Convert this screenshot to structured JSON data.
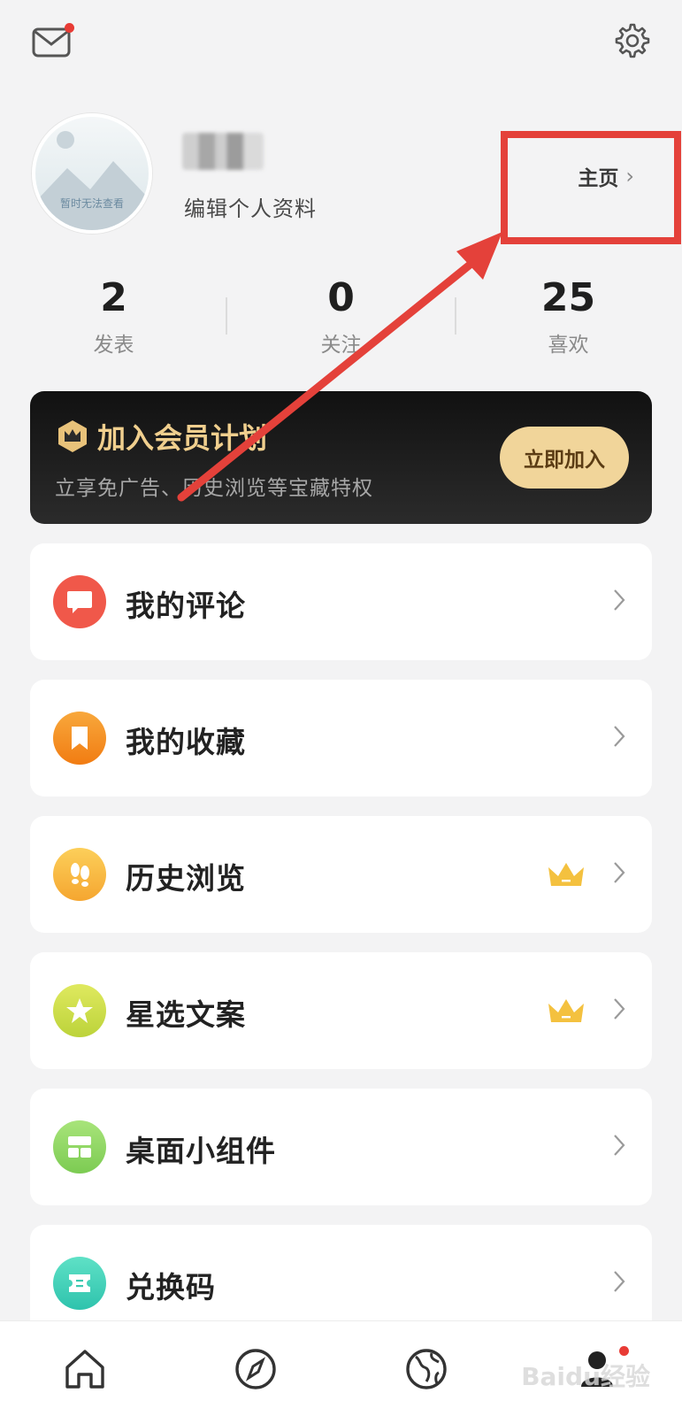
{
  "header": {
    "mail_icon": "mail-icon",
    "settings_icon": "gear-icon"
  },
  "profile": {
    "avatar_caption": "暂时无法查看",
    "edit_label": "编辑个人资料",
    "homepage_label": "主页",
    "homepage_chevron": "›"
  },
  "stats": [
    {
      "value": "2",
      "label": "发表"
    },
    {
      "value": "0",
      "label": "关注"
    },
    {
      "value": "25",
      "label": "喜欢"
    }
  ],
  "vip": {
    "title": "加入会员计划",
    "subtitle": "立享免广告、历史浏览等宝藏特权",
    "button_label": "立即加入"
  },
  "menu": [
    {
      "label": "我的评论",
      "icon": "comment-icon",
      "color": "#f0584a",
      "premium": false
    },
    {
      "label": "我的收藏",
      "icon": "bookmark-icon",
      "color": "#f5961f",
      "premium": false
    },
    {
      "label": "历史浏览",
      "icon": "footprint-icon",
      "color": "#f7bd3c",
      "premium": true
    },
    {
      "label": "星选文案",
      "icon": "star-icon",
      "color": "#cfe04e",
      "premium": true
    },
    {
      "label": "桌面小组件",
      "icon": "widget-icon",
      "color": "#93d86a",
      "premium": false
    },
    {
      "label": "兑换码",
      "icon": "ticket-icon",
      "color": "#47d2b9",
      "premium": false
    }
  ],
  "bottom_nav": [
    "home-icon",
    "compass-icon",
    "globe-icon",
    "profile-icon"
  ],
  "colors": {
    "accent_gold": "#f0cf8e",
    "annotation_red": "#e4413a",
    "notification_red": "#e83b35"
  },
  "watermark": "Baidu经验"
}
